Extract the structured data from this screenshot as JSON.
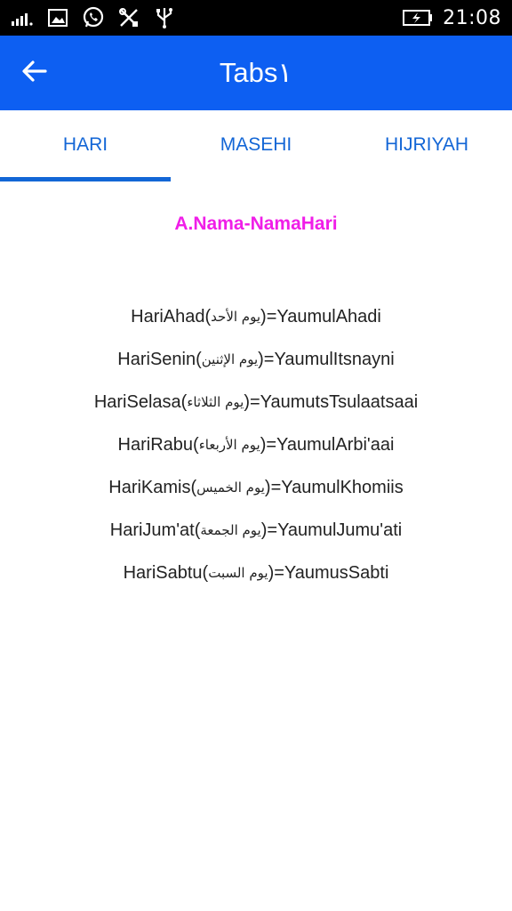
{
  "status_bar": {
    "time": "21:08",
    "icons": [
      "signal-icon",
      "image-icon",
      "whatsapp-icon",
      "tools-icon",
      "usb-icon",
      "battery-icon"
    ]
  },
  "app_bar": {
    "title": "Tabs١",
    "back_icon": "arrow-left-icon",
    "color": "#0d5ff2"
  },
  "tabs": [
    {
      "label": "HARI",
      "active": true
    },
    {
      "label": "MASEHI",
      "active": false
    },
    {
      "label": "HIJRIYAH",
      "active": false
    }
  ],
  "content": {
    "title": "A.Nama-NamaHari",
    "title_color": "#f01ee8",
    "rows": [
      {
        "latin_left": "HariAhad(",
        "arabic": "يوم الأحد",
        "latin_right": ")=YaumulAhadi"
      },
      {
        "latin_left": "HariSenin(",
        "arabic": "يوم الإثنين",
        "latin_right": ")=YaumulItsnayni"
      },
      {
        "latin_left": "HariSelasa(",
        "arabic": "يوم الثلاثاء",
        "latin_right": ")=YaumutsTsulaatsaai"
      },
      {
        "latin_left": "HariRabu(",
        "arabic": "يوم الأربعاء",
        "latin_right": ")=YaumulArbi'aai"
      },
      {
        "latin_left": "HariKamis(",
        "arabic": "يوم الخميس",
        "latin_right": ")=YaumulKhomiis"
      },
      {
        "latin_left": "HariJum'at(",
        "arabic": "يوم الجمعة",
        "latin_right": ")=YaumulJumu'ati"
      },
      {
        "latin_left": "HariSabtu(",
        "arabic": "يوم السبت",
        "latin_right": ")=YaumusSabti"
      }
    ]
  }
}
